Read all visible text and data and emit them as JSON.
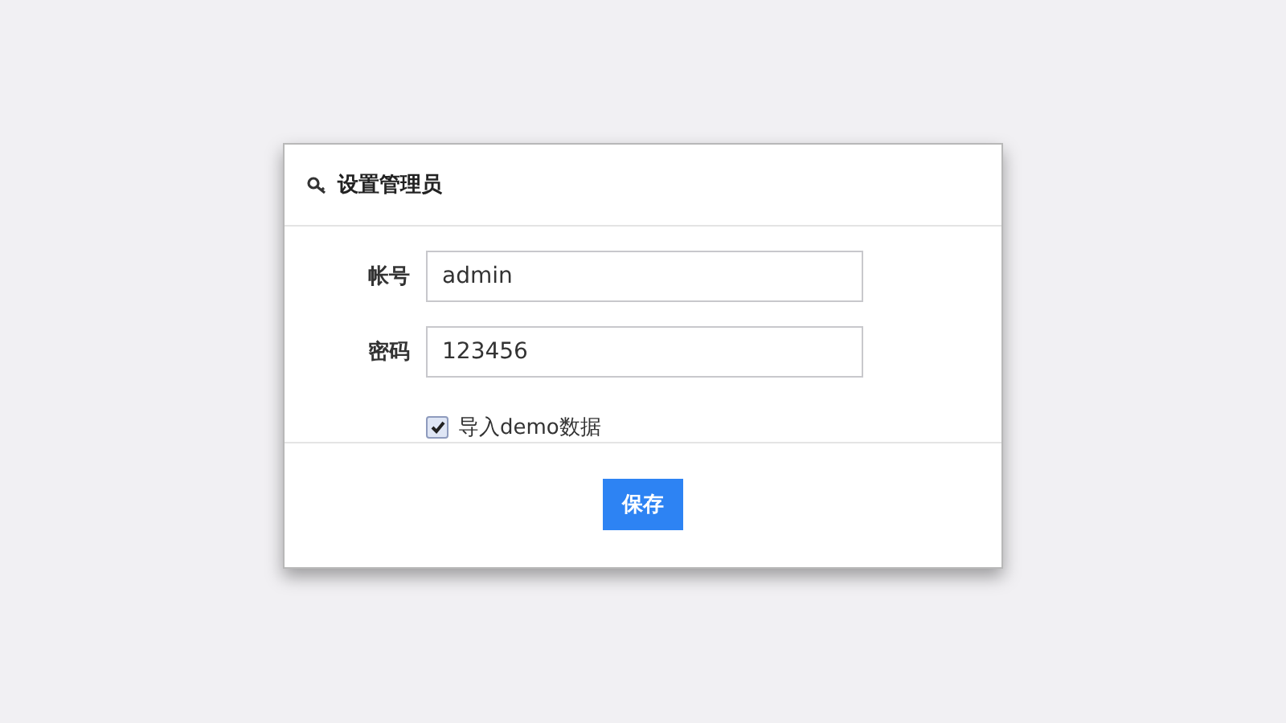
{
  "dialog": {
    "title": "设置管理员",
    "fields": [
      {
        "label": "帐号",
        "value": "admin"
      },
      {
        "label": "密码",
        "value": "123456"
      }
    ],
    "checkbox": {
      "label": "导入demo数据",
      "checked": true
    },
    "buttons": [
      "保存"
    ]
  }
}
